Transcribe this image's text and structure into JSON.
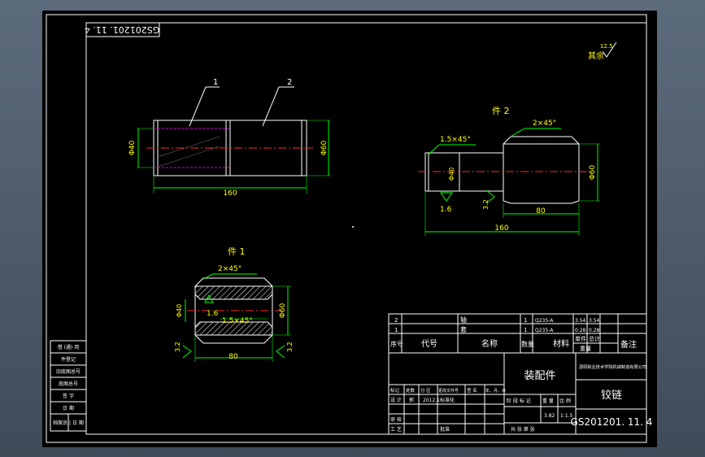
{
  "drawing": {
    "code_mirrored": "GS201201. 11. 4",
    "roughness_note": "其余",
    "roughness_value": "12.5",
    "part2_title": "件 2",
    "part1_title": "件 1",
    "colors": {
      "frame": "#ffffff",
      "dim": "#00ff00",
      "center": "#ff2a2a",
      "hidden": "#d000d0",
      "text": "#ffffff",
      "title": "#ffff00"
    }
  },
  "assembly": {
    "balloon1": "1",
    "balloon2": "2",
    "dia_left": "Φ40",
    "dia_right": "Φ60",
    "length": "160"
  },
  "part2": {
    "chamfer_left": "1.5×45°",
    "chamfer_right": "2×45°",
    "dia_small": "Φ40",
    "dia_large": "Φ60",
    "len_80": "80",
    "len_160": "160",
    "rough_left": "1.6",
    "rough_right": "3.2"
  },
  "part1": {
    "chamfer_top": "2×45°",
    "chamfer_inner": "1.5×45°",
    "dia_inner": "Φ40",
    "dia_outer": "Φ60",
    "len_80": "80",
    "rough_inner": "1.6",
    "rough_left": "3.2",
    "rough_right": "3.2"
  },
  "sidebar": [
    "借 (通) 用",
    "件登记",
    "旧底图总号",
    "底图总号",
    "签 字",
    "日 期",
    "档案员 | 日 期"
  ],
  "bom": {
    "rows": [
      {
        "no": "2",
        "name": "轴",
        "qty": "1",
        "material": "Q235-A",
        "unit_wt": "3.54",
        "total_wt": "3.54"
      },
      {
        "no": "1",
        "name": "套",
        "qty": "1",
        "material": "Q235-A",
        "unit_wt": "0.28",
        "total_wt": "0.28"
      }
    ],
    "header": {
      "no": "序号",
      "code": "代号",
      "name": "名称",
      "qty": "数量",
      "material": "材料",
      "unit_wt": "单件",
      "total_wt": "总计",
      "weight": "重量",
      "remark": "备注"
    }
  },
  "titleblock": {
    "company": "邵阳职业技术学院机械制造有限公司",
    "assembly_name": "装配件",
    "part_name": "铰链",
    "drawing_no": "GS201201. 11. 4",
    "rev_labels": [
      "标记",
      "处数",
      "分 区",
      "更改文件号",
      "签 名",
      "年、月、日"
    ],
    "design_label": "设 计",
    "designer": "郭",
    "date": "2012.1",
    "std_label": "标准化",
    "check_label": "审 核",
    "process_label": "工 艺",
    "approve_label": "批准",
    "stage_label": "阶 段 标 记",
    "weight_label": "重 量",
    "scale_label": "比 例",
    "weight_value": "3.82",
    "scale_value": "1:1.5",
    "sheets_label": "共   张  第   张"
  }
}
